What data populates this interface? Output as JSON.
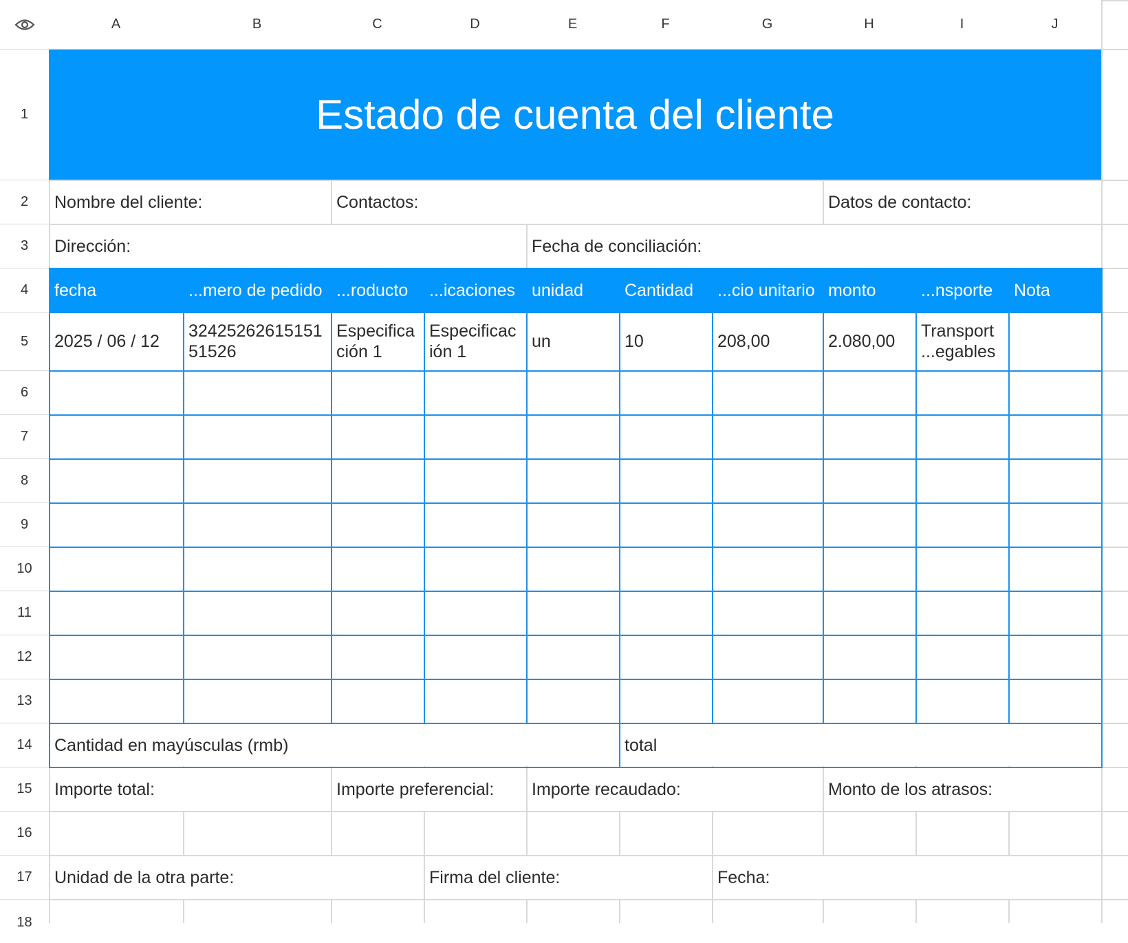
{
  "sheet": {
    "corner_icon": "eye-icon",
    "columns": [
      "A",
      "B",
      "C",
      "D",
      "E",
      "F",
      "G",
      "H",
      "I",
      "J"
    ],
    "rows": [
      "1",
      "2",
      "3",
      "4",
      "5",
      "6",
      "7",
      "8",
      "9",
      "10",
      "11",
      "12",
      "13",
      "14",
      "15",
      "16",
      "17",
      "18"
    ]
  },
  "title": "Estado de cuenta del cliente",
  "info": {
    "customer_name_label": "Nombre del cliente:",
    "contacts_label": "Contactos:",
    "contact_data_label": "Datos de contacto:",
    "address_label": "Dirección:",
    "reconciliation_date_label": "Fecha de conciliación:"
  },
  "table": {
    "headers": [
      "fecha",
      "...mero de pedido",
      "...roducto",
      "...icaciones",
      "unidad",
      "Cantidad",
      "...cio unitario",
      "monto",
      "...nsporte",
      "Nota"
    ],
    "rows": [
      [
        "2025 / 06 / 12",
        "3242526261515151526",
        "Especificación 1",
        "Especificación 1",
        "un",
        "10",
        "208,00",
        "2.080,00",
        "Transport ...egables",
        ""
      ]
    ],
    "display": {
      "order_line1": "32425262615151",
      "order_line2": "51526",
      "product_line1": "Especifica",
      "product_line2": "ción 1",
      "spec_line1": "Especificac",
      "spec_line2": "ión 1",
      "transport_line1": "Transport",
      "transport_line2": "...egables"
    }
  },
  "totals": {
    "amount_in_words_label": "Cantidad en mayúsculas (rmb)",
    "total_label": "total"
  },
  "amounts": {
    "total_amount_label": "Importe total:",
    "preferential_amount_label": "Importe preferencial:",
    "collected_amount_label": "Importe recaudado:",
    "arrears_amount_label": "Monto de los atrasos:"
  },
  "signature": {
    "counterparty_label": "Unidad de la otra parte:",
    "customer_signature_label": "Firma del cliente:",
    "date_label": "Fecha:"
  },
  "colors": {
    "accent": "#0396fc",
    "grid_blue": "#1e90ea",
    "grid_gray": "#d9d9d9"
  }
}
